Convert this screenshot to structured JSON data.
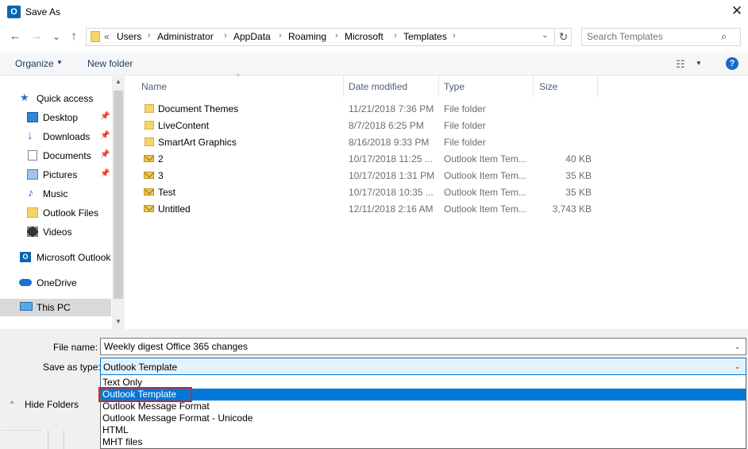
{
  "window": {
    "title": "Save As",
    "app_icon_text": "O",
    "close_glyph": "✕"
  },
  "nav": {
    "back": "←",
    "forward": "→",
    "recent": "⌄",
    "up": "↑"
  },
  "address": {
    "prefix": "«",
    "crumbs": [
      "Users",
      "Administrator",
      "AppData",
      "Roaming",
      "Microsoft",
      "Templates"
    ],
    "separator": "›",
    "dropdown": "⌄",
    "refresh": "↻"
  },
  "search": {
    "placeholder": "Search Templates",
    "icon": "⌕"
  },
  "toolbar": {
    "organize_label": "Organize",
    "organize_arrow": "▼",
    "new_folder_label": "New folder",
    "view_icon": "☷",
    "view_arrow": "▼",
    "help_label": "?"
  },
  "nav_pane": {
    "items": [
      {
        "label": "Quick access",
        "icon": "star-icon",
        "pinned": false
      },
      {
        "label": "Desktop",
        "icon": "desktop-icon",
        "pinned": true
      },
      {
        "label": "Downloads",
        "icon": "download-icon",
        "pinned": true
      },
      {
        "label": "Documents",
        "icon": "documents-icon",
        "pinned": true
      },
      {
        "label": "Pictures",
        "icon": "pictures-icon",
        "pinned": true
      },
      {
        "label": "Music",
        "icon": "music-icon",
        "pinned": false
      },
      {
        "label": "Outlook Files",
        "icon": "folder-icon",
        "pinned": false
      },
      {
        "label": "Videos",
        "icon": "videos-icon",
        "pinned": false
      },
      {
        "label": "Microsoft Outlook",
        "icon": "outlook-icon",
        "pinned": false
      },
      {
        "label": "OneDrive",
        "icon": "onedrive-icon",
        "pinned": false
      },
      {
        "label": "This PC",
        "icon": "this-pc-icon",
        "pinned": false
      }
    ],
    "pin_glyph": "📌",
    "scroll_up": "▲",
    "scroll_down": "▼"
  },
  "file_list": {
    "columns": [
      "Name",
      "Date modified",
      "Type",
      "Size"
    ],
    "sort_arrow": "^",
    "rows": [
      {
        "name": "Document Themes",
        "date": "11/21/2018 7:36 PM",
        "type": "File folder",
        "size": "",
        "icon": "folder-icon"
      },
      {
        "name": "LiveContent",
        "date": "8/7/2018 6:25 PM",
        "type": "File folder",
        "size": "",
        "icon": "folder-icon"
      },
      {
        "name": "SmartArt Graphics",
        "date": "8/16/2018 9:33 PM",
        "type": "File folder",
        "size": "",
        "icon": "folder-icon"
      },
      {
        "name": "2",
        "date": "10/17/2018 11:25 ...",
        "type": "Outlook Item Tem...",
        "size": "40 KB",
        "icon": "mail-template-icon"
      },
      {
        "name": "3",
        "date": "10/17/2018 1:31 PM",
        "type": "Outlook Item Tem...",
        "size": "35 KB",
        "icon": "mail-template-icon"
      },
      {
        "name": "Test",
        "date": "10/17/2018 10:35 ...",
        "type": "Outlook Item Tem...",
        "size": "35 KB",
        "icon": "mail-template-icon"
      },
      {
        "name": "Untitled",
        "date": "12/11/2018 2:16 AM",
        "type": "Outlook Item Tem...",
        "size": "3,743 KB",
        "icon": "mail-template-icon"
      }
    ]
  },
  "save_panel": {
    "filename_label": "File name:",
    "filename_value": "Weekly digest Office 365 changes",
    "savetype_label": "Save as type:",
    "savetype_value": "Outlook Template",
    "dropdown_arrow": "⌄",
    "options": [
      "Text Only",
      "Outlook Template",
      "Outlook Message Format",
      "Outlook Message Format - Unicode",
      "HTML",
      "MHT files"
    ],
    "selected_option": "Outlook Template",
    "hide_folders_label": "Hide Folders",
    "hide_chevron": "^"
  },
  "colors": {
    "accent": "#0078d7",
    "highlight_box": "#d6232b",
    "folder": "#f5d56a"
  }
}
